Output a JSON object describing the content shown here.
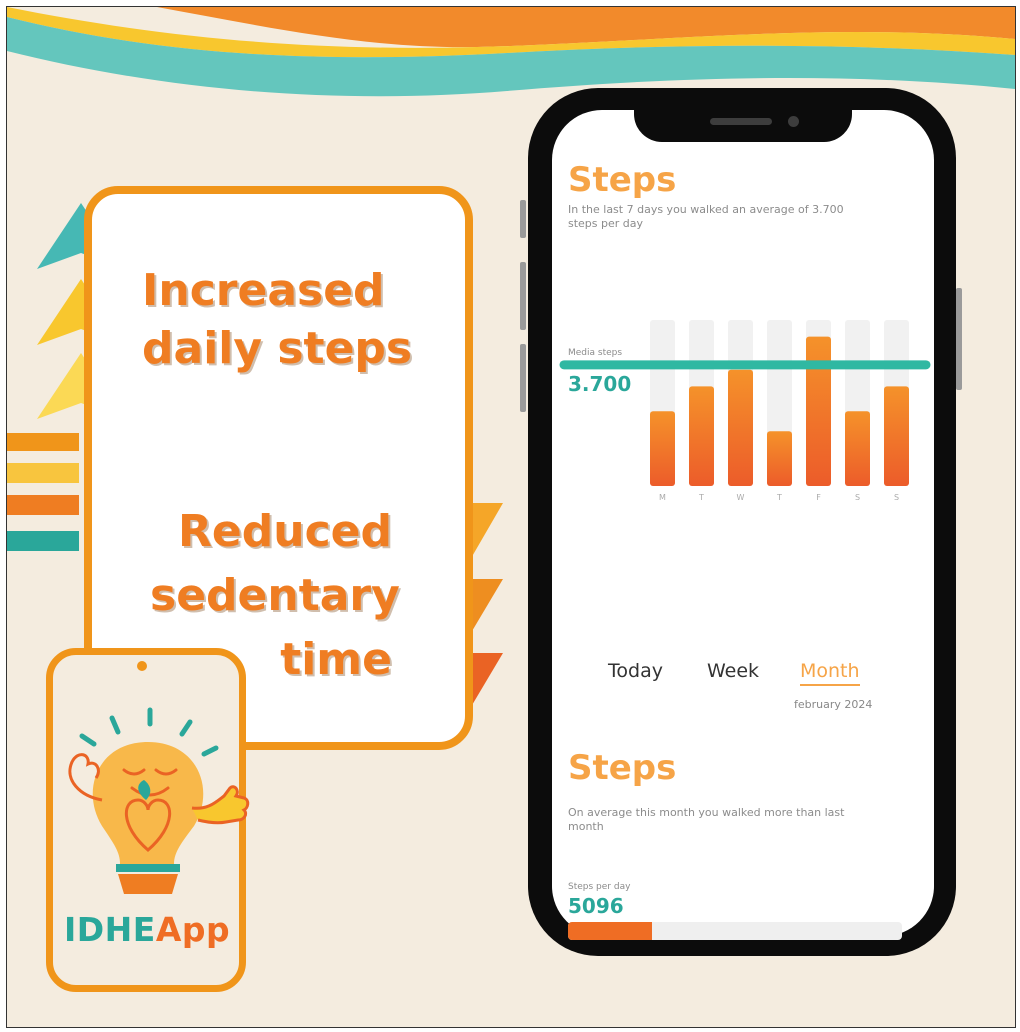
{
  "promo": {
    "headline_increase": [
      "Increased",
      "daily steps"
    ],
    "headline_reduce": [
      "Reduced",
      "sedentary",
      "time"
    ],
    "logo": {
      "part1": "IDHE",
      "part2": "App"
    },
    "colors": {
      "orange": "#ef7d22",
      "teal": "#2aa79a",
      "yellow": "#f7c42a",
      "cream": "#f4ecdf",
      "border": "#f0951a"
    }
  },
  "app": {
    "section1": {
      "title": "Steps",
      "subtitle": "In the last 7 days you walked an average of 3.700 steps per day",
      "avg_label": "Media steps",
      "avg_value": "3.700"
    },
    "chart_data": {
      "type": "bar",
      "categories": [
        "M",
        "T",
        "W",
        "T",
        "F",
        "S",
        "S"
      ],
      "values": [
        0.45,
        0.6,
        0.7,
        0.33,
        0.9,
        0.45,
        0.6
      ],
      "average_line": 0.73,
      "title": "",
      "xlabel": "",
      "ylabel": "",
      "ylim": [
        0,
        1
      ],
      "grid": false,
      "legend": "none"
    },
    "tabs": [
      {
        "label": "Today",
        "active": false
      },
      {
        "label": "Week",
        "active": false
      },
      {
        "label": "Month",
        "active": true
      }
    ],
    "period": "february 2024",
    "section2": {
      "title": "Steps",
      "subtitle": "On average this month you walked more than last month",
      "spd_label": "Steps per day",
      "spd_value": "5096",
      "progress": 0.25
    }
  }
}
